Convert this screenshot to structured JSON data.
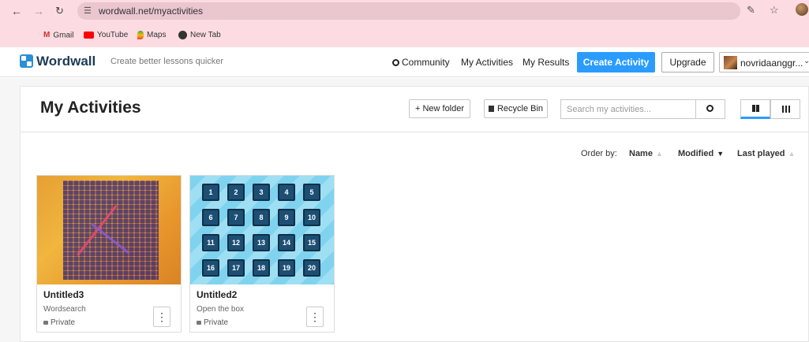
{
  "browser": {
    "url": "wordwall.net/myactivities",
    "bookmarks": [
      "Gmail",
      "YouTube",
      "Maps",
      "New Tab"
    ]
  },
  "site": {
    "logo": "Wordwall",
    "tagline": "Create better lessons quicker",
    "nav": {
      "community": "Community",
      "my_activities": "My Activities",
      "my_results": "My Results",
      "create_activity": "Create Activity",
      "upgrade": "Upgrade",
      "username": "novridaanggr..."
    }
  },
  "page": {
    "title": "My Activities",
    "new_folder": "+ New folder",
    "recycle_bin": "Recycle Bin",
    "search_placeholder": "Search my activities...",
    "order_by_label": "Order by:",
    "order_options": [
      "Name",
      "Modified",
      "Last played"
    ]
  },
  "activities": [
    {
      "title": "Untitled3",
      "type": "Wordsearch",
      "privacy": "Private"
    },
    {
      "title": "Untitled2",
      "type": "Open the box",
      "privacy": "Private",
      "tiles": [
        "1",
        "2",
        "3",
        "4",
        "5",
        "6",
        "7",
        "8",
        "9",
        "10",
        "11",
        "12",
        "13",
        "14",
        "15",
        "16",
        "17",
        "18",
        "19",
        "20"
      ]
    }
  ],
  "colors": {
    "accent": "#2b9cff",
    "chrome": "#fcdbe2",
    "tile": "#1d4f74"
  }
}
